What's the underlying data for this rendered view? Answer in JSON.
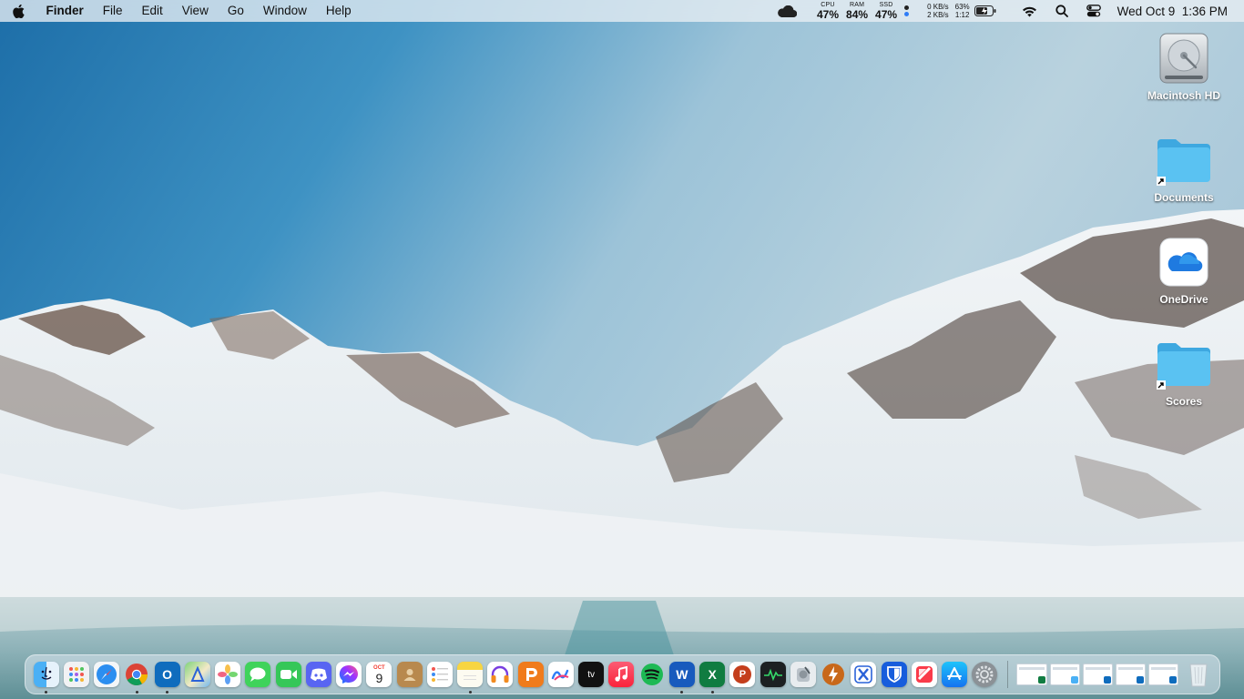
{
  "menubar": {
    "app_name": "Finder",
    "menus": [
      "File",
      "Edit",
      "View",
      "Go",
      "Window",
      "Help"
    ],
    "stats": {
      "cpu_label": "CPU",
      "cpu_value": "47%",
      "ram_label": "RAM",
      "ram_value": "84%",
      "ssd_label": "SSD",
      "ssd_value": "47%"
    },
    "network": {
      "up": "0 KB/s",
      "down": "2 KB/s"
    },
    "battery": {
      "percent": "63%",
      "time": "1:12"
    },
    "date": "Wed Oct 9",
    "time": "1:36 PM"
  },
  "desktop": [
    {
      "label": "Macintosh HD",
      "icon": "hard-drive-icon"
    },
    {
      "label": "Documents",
      "icon": "folder-icon"
    },
    {
      "label": "OneDrive",
      "icon": "onedrive-icon"
    },
    {
      "label": "Scores",
      "icon": "folder-icon"
    }
  ],
  "dock": {
    "calendar_month": "OCT",
    "calendar_day": "9",
    "tv_label": "tv",
    "excel_letter": "X",
    "word_letter": "W",
    "outlook_letter": "O",
    "powerpoint_letter": "P",
    "bitwarden_letter": "U"
  },
  "colors": {
    "accent_blue": "#2f7cf6",
    "folder_blue": "#5ac2f2",
    "spotify": "#1db954",
    "messages_green": "#3fd35b"
  }
}
